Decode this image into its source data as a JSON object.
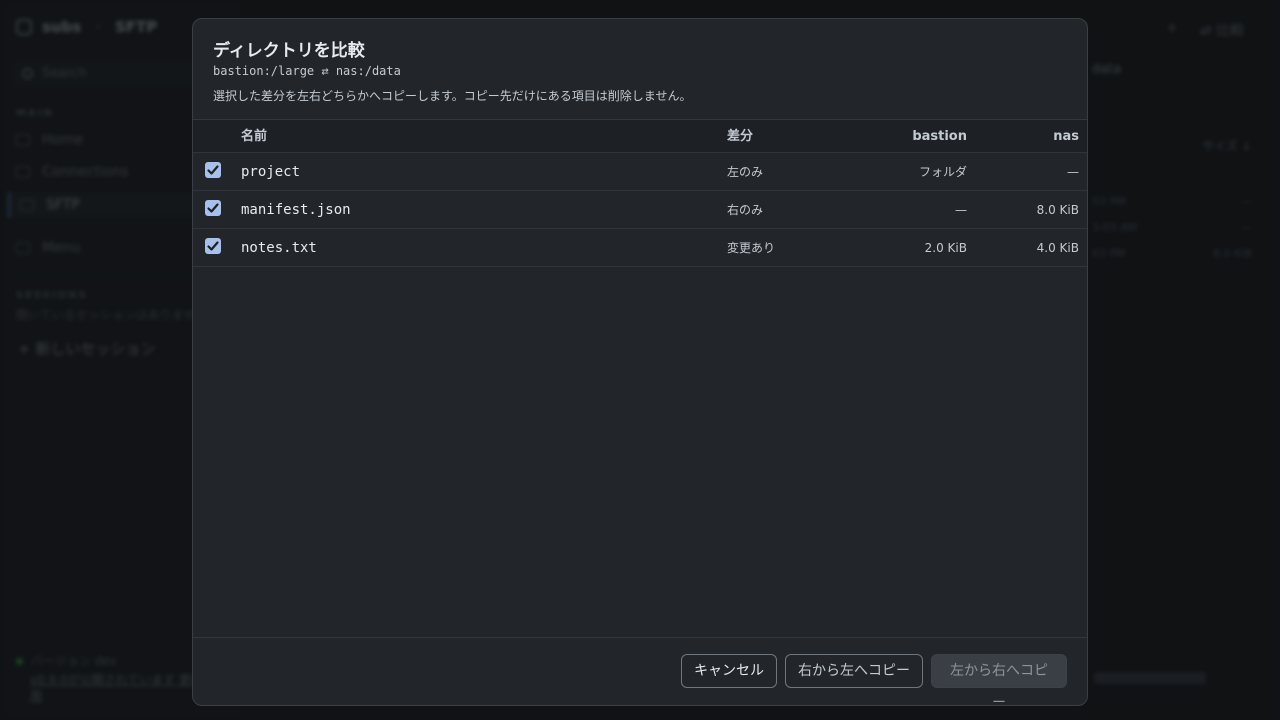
{
  "background": {
    "app_name": "subs",
    "app_section": "SFTP",
    "search_placeholder": "Search",
    "section_main": "MAIN",
    "nav": [
      "Home",
      "Connections",
      "SFTP",
      "Menu"
    ],
    "section_sessions": "SESSIONS",
    "sessions_note": "開いているセッションはありません",
    "new_session": "+ 新しいセッション",
    "footer_status": "バージョン dev",
    "footer_link": "v0.9.0が公開されています 更新を適用",
    "right_title": "data",
    "right_top_a": "+",
    "right_top_b": "⇄ 比較",
    "right_header": "サイズ ↓",
    "right_rows": [
      {
        "time": "03 PM",
        "size": "—"
      },
      {
        "time": "3:03 AM",
        "size": "—"
      },
      {
        "time": "03 PM",
        "size": "8.0 KiB"
      }
    ]
  },
  "dialog": {
    "title": "ディレクトリを比較",
    "path": "bastion:/large ⇄ nas:/data",
    "description": "選択した差分を左右どちらかへコピーします。コピー先だけにある項目は削除しません。",
    "columns": {
      "name": "名前",
      "diff": "差分",
      "left": "bastion",
      "right": "nas"
    },
    "rows": [
      {
        "checked": true,
        "name": "project",
        "diff": "左のみ",
        "left": "フォルダ",
        "right": "—"
      },
      {
        "checked": true,
        "name": "manifest.json",
        "diff": "右のみ",
        "left": "—",
        "right": "8.0 KiB"
      },
      {
        "checked": true,
        "name": "notes.txt",
        "diff": "変更あり",
        "left": "2.0 KiB",
        "right": "4.0 KiB"
      }
    ],
    "buttons": {
      "cancel": "キャンセル",
      "copy_right_to_left": "右から左へコピー",
      "copy_left_to_right": "左から右へコピー"
    }
  },
  "colors": {
    "accent": "#a8c1ea",
    "modal_bg": "#22262a",
    "disabled_button": "#3a3f46"
  }
}
